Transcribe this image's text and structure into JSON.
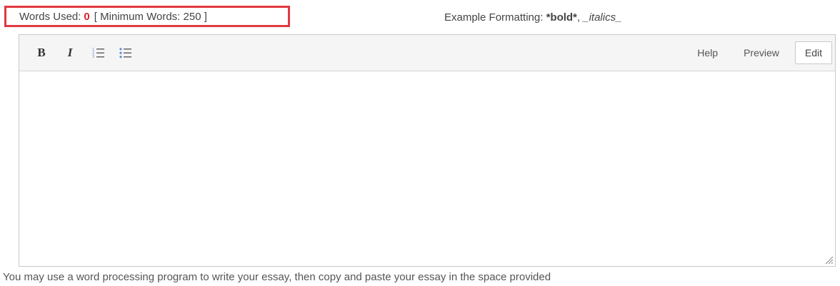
{
  "word_count": {
    "label": "Words Used:",
    "count": "0",
    "minimum": "[ Minimum Words: 250 ]",
    "highlight_color": "#e0393e"
  },
  "formatting_hint": {
    "prefix": "Example Formatting:",
    "bold_example": "*bold*",
    "separator": ",",
    "italic_example": "_italics_"
  },
  "toolbar": {
    "bold_label": "B",
    "italic_label": "I",
    "ordered_list_icon": "ordered-list-icon",
    "unordered_list_icon": "unordered-list-icon",
    "help_label": "Help",
    "preview_label": "Preview",
    "edit_label": "Edit"
  },
  "editor": {
    "value": ""
  },
  "footer": {
    "note": "You may use a word processing program to write your essay, then copy and paste your essay in the space provided"
  }
}
